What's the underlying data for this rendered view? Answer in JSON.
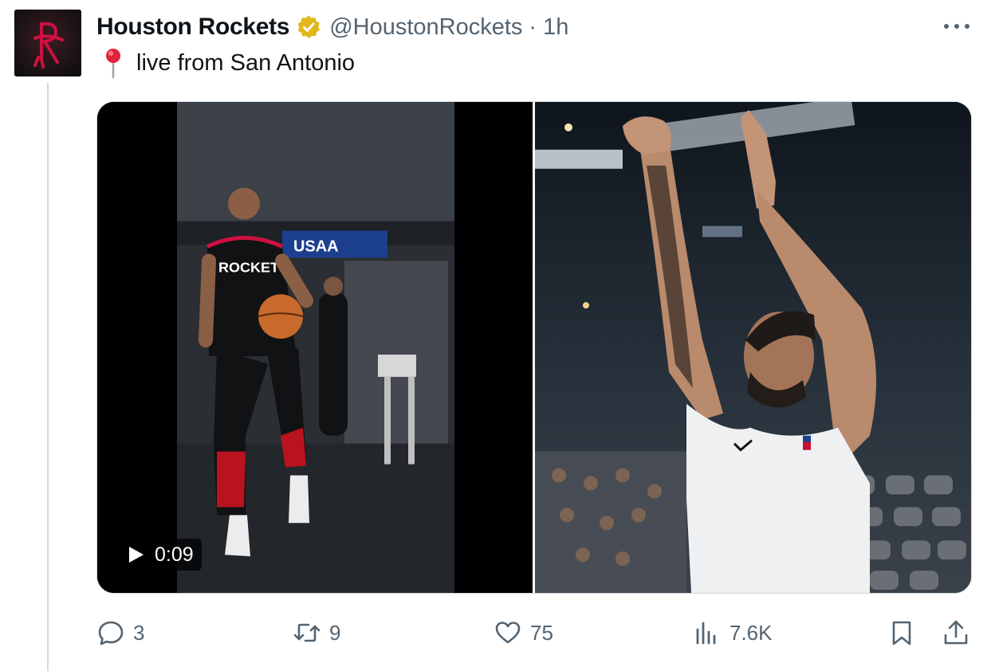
{
  "tweet": {
    "author_name": "Houston Rockets",
    "handle": "@HoustonRockets",
    "separator": "·",
    "time": "1h",
    "text": "live from San Antonio"
  },
  "media": {
    "video_duration": "0:09",
    "left_sign_text": "USAA",
    "jersey_text": "ROCKETS"
  },
  "actions": {
    "replies": "3",
    "retweets": "9",
    "likes": "75",
    "views": "7.6K"
  },
  "icons": {
    "avatar": "rockets-logo-icon",
    "verified": "verified-badge-icon",
    "pin": "round-pushpin-icon",
    "more": "more-options-icon",
    "reply": "reply-icon",
    "retweet": "retweet-icon",
    "like": "heart-icon",
    "views": "views-chart-icon",
    "bookmark": "bookmark-icon",
    "share": "share-icon"
  },
  "colors": {
    "text_primary": "#0f1419",
    "text_secondary": "#536471",
    "verified_gold": "#e2b719",
    "rockets_red": "#ce1141",
    "border": "#cfd9de"
  }
}
